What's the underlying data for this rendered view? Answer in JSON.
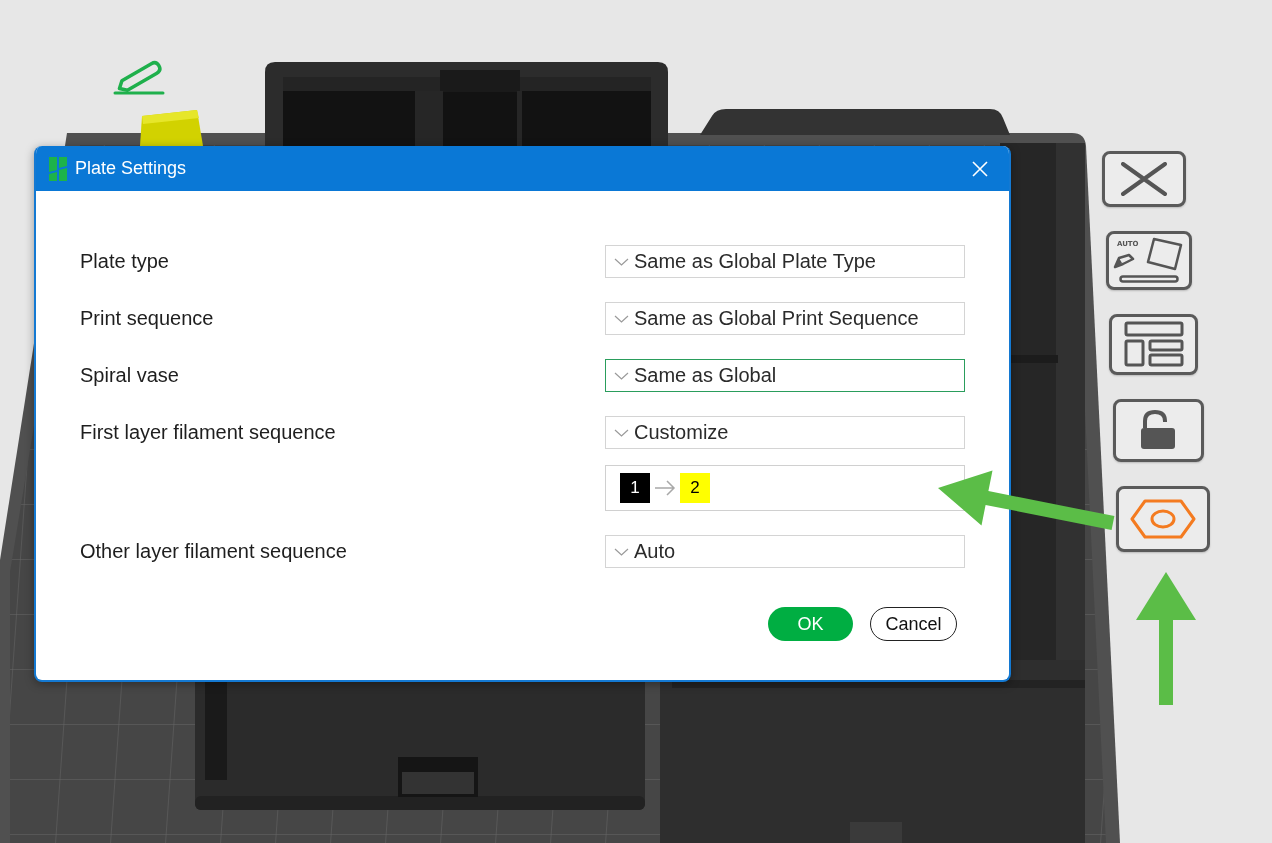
{
  "canvas": {
    "toolbar": [
      {
        "kind": "delete",
        "highlighted": false
      },
      {
        "kind": "auto-orient",
        "label": "AUTO",
        "highlighted": false
      },
      {
        "kind": "arrange",
        "highlighted": false
      },
      {
        "kind": "lock",
        "highlighted": false
      },
      {
        "kind": "plate-settings",
        "highlighted": true
      }
    ]
  },
  "dialog": {
    "title": "Plate Settings",
    "settings": [
      {
        "label": "Plate type",
        "value": "Same as Global Plate Type",
        "focused": false
      },
      {
        "label": "Print sequence",
        "value": "Same as Global Print Sequence",
        "focused": false
      },
      {
        "label": "Spiral vase",
        "value": "Same as Global",
        "focused": true
      },
      {
        "label": "First layer filament sequence",
        "value": "Customize",
        "focused": false,
        "sequence": [
          {
            "number": "1",
            "color": "#000000"
          },
          {
            "number": "2",
            "color": "#ffff00"
          }
        ]
      },
      {
        "label": "Other layer filament sequence",
        "value": "Auto",
        "focused": false
      }
    ],
    "buttons": [
      {
        "label": "OK",
        "kind": "primary"
      },
      {
        "label": "Cancel",
        "kind": "secondary"
      }
    ]
  }
}
